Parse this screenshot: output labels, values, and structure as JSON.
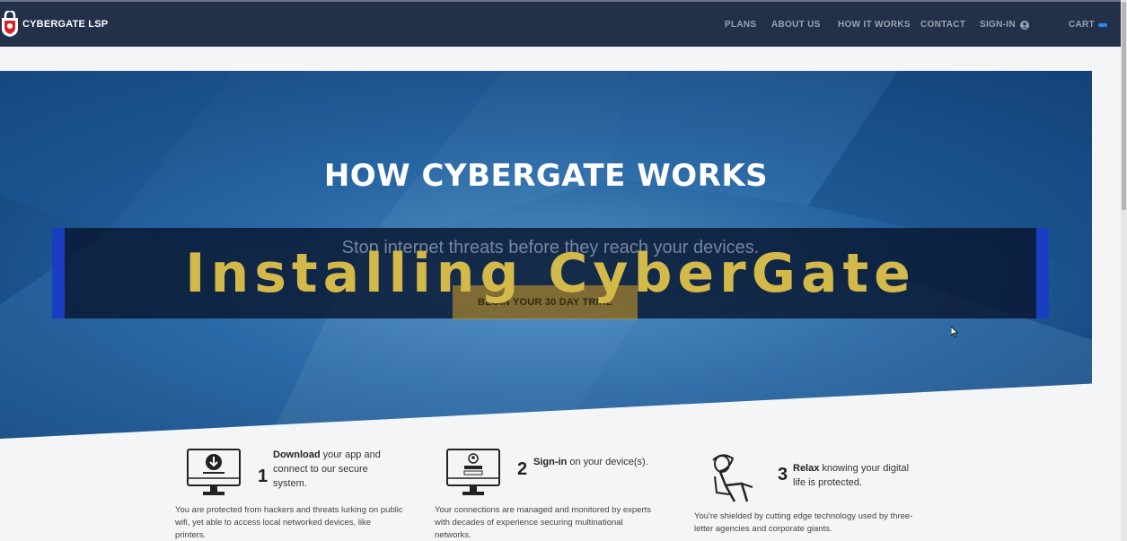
{
  "brand": {
    "name": "CYBERGATE LSP"
  },
  "nav": {
    "plans": "PLANS",
    "about": "ABOUT US",
    "how": "HOW IT WORKS",
    "contact": "CONTACT",
    "signin": "SIGN-IN",
    "cart": "CART"
  },
  "hero": {
    "title": "HOW CYBERGATE WORKS",
    "subtitle": "Stop internet threats before they reach your devices.",
    "cta": "BEGIN YOUR 30 DAY TRIAL"
  },
  "caption": {
    "text": "Installing CyberGate"
  },
  "steps": [
    {
      "number": "1",
      "bold": "Download",
      "rest": " your app and connect to our secure system.",
      "desc": "You are protected from hackers and threats lurking on public wifi, yet able to access local networked devices, like printers."
    },
    {
      "number": "2",
      "bold": "Sign-in",
      "rest": " on your device(s).",
      "desc": "Your connections are managed and monitored by experts with decades of experience securing multinational networks."
    },
    {
      "number": "3",
      "bold": "Relax",
      "rest": " knowing your digital life is protected.",
      "desc": "You're shielded by cutting edge technology used by three-letter agencies and corporate giants."
    }
  ],
  "colors": {
    "navbar": "#22304a",
    "caption": "#d3b84a",
    "cta": "#c49628",
    "accent": "#2b86f0"
  },
  "icons": [
    "shield-logo-icon",
    "user-circle-icon",
    "cart-indicator-icon",
    "download-monitor-icon",
    "signin-monitor-icon",
    "relax-person-icon",
    "mouse-cursor-icon"
  ]
}
